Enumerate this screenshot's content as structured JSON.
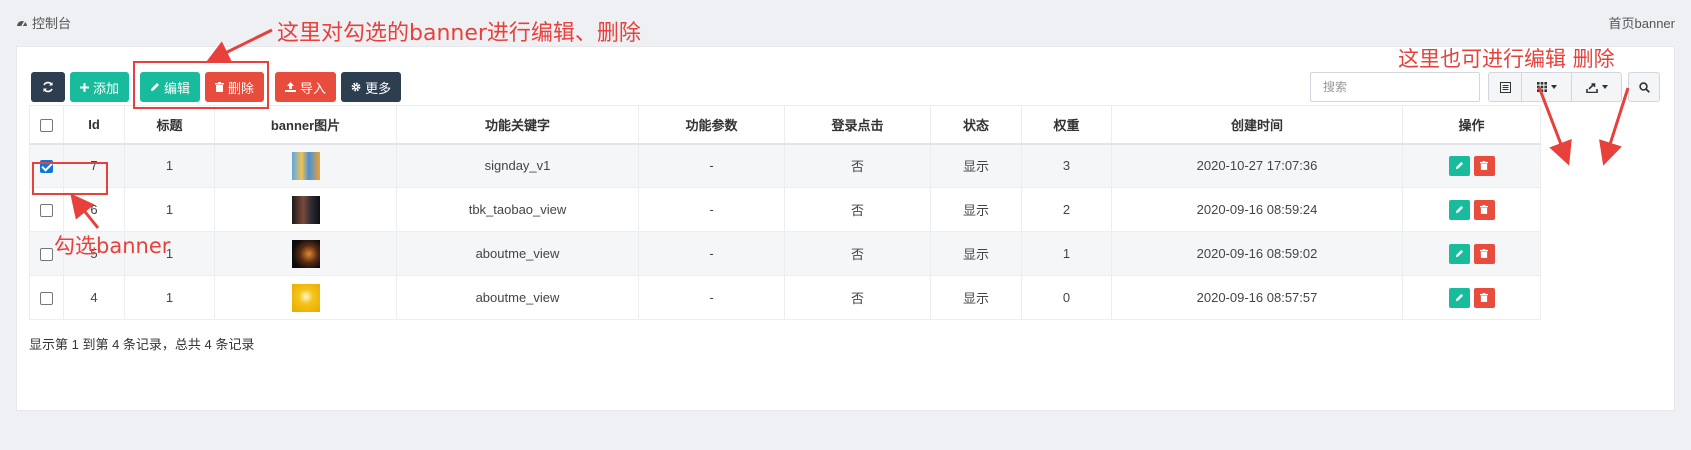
{
  "topbar": {
    "console_label": "控制台",
    "breadcrumb": "首页banner"
  },
  "toolbar": {
    "add_label": "添加",
    "edit_label": "编辑",
    "delete_label": "删除",
    "import_label": "导入",
    "more_label": "更多"
  },
  "search": {
    "placeholder": "搜索"
  },
  "columns": [
    "Id",
    "标题",
    "banner图片",
    "功能关键字",
    "功能参数",
    "登录点击",
    "状态",
    "权重",
    "创建时间",
    "操作"
  ],
  "rows": [
    {
      "id": "7",
      "title": "1",
      "keyword": "signday_v1",
      "param": "-",
      "login_click": "否",
      "status": "显示",
      "weight": "3",
      "created": "2020-10-27 17:07:36",
      "checked": true
    },
    {
      "id": "6",
      "title": "1",
      "keyword": "tbk_taobao_view",
      "param": "-",
      "login_click": "否",
      "status": "显示",
      "weight": "2",
      "created": "2020-09-16 08:59:24",
      "checked": false
    },
    {
      "id": "5",
      "title": "1",
      "keyword": "aboutme_view",
      "param": "-",
      "login_click": "否",
      "status": "显示",
      "weight": "1",
      "created": "2020-09-16 08:59:02",
      "checked": false
    },
    {
      "id": "4",
      "title": "1",
      "keyword": "aboutme_view",
      "param": "-",
      "login_click": "否",
      "status": "显示",
      "weight": "0",
      "created": "2020-09-16 08:57:57",
      "checked": false
    }
  ],
  "summary": "显示第 1 到第 4 条记录，总共 4 条记录",
  "annotations": {
    "top": "这里对勾选的banner进行编辑、删除",
    "right": "这里也可进行编辑 删除",
    "check": "勾选banner"
  },
  "colors": {
    "green": "#18bc9c",
    "red": "#e74c3c",
    "dark": "#2c3e50",
    "annotation": "#e8403b"
  }
}
